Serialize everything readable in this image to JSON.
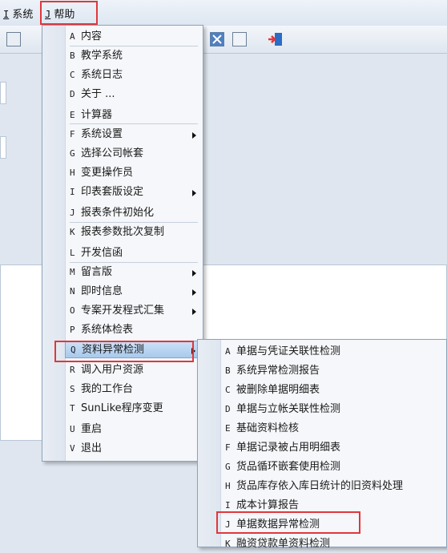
{
  "menubar": {
    "items": [
      {
        "key": "I",
        "label": "系统"
      },
      {
        "key": "J",
        "label": "帮助"
      }
    ]
  },
  "help_menu": {
    "items": [
      {
        "key": "A",
        "label": "内容",
        "submenu": false
      },
      {
        "key": "B",
        "label": "教学系统",
        "submenu": false
      },
      {
        "key": "C",
        "label": "系统日志",
        "submenu": false
      },
      {
        "key": "D",
        "label": "关于 ...",
        "submenu": false
      },
      {
        "key": "E",
        "label": "计算器",
        "submenu": false
      },
      {
        "key": "F",
        "label": "系统设置",
        "submenu": true
      },
      {
        "key": "G",
        "label": "选择公司帐套",
        "submenu": false
      },
      {
        "key": "H",
        "label": "变更操作员",
        "submenu": false
      },
      {
        "key": "I",
        "label": "印表套版设定",
        "submenu": true
      },
      {
        "key": "J",
        "label": "报表条件初始化",
        "submenu": false
      },
      {
        "key": "K",
        "label": "报表参数批次复制",
        "submenu": false
      },
      {
        "key": "L",
        "label": "开发信函",
        "submenu": false
      },
      {
        "key": "M",
        "label": "留言版",
        "submenu": true
      },
      {
        "key": "N",
        "label": "即时信息",
        "submenu": true
      },
      {
        "key": "O",
        "label": "专案开发程式汇集",
        "submenu": true
      },
      {
        "key": "P",
        "label": "系统体检表",
        "submenu": false
      },
      {
        "key": "Q",
        "label": "资料异常检测",
        "submenu": true
      },
      {
        "key": "R",
        "label": "调入用户资源",
        "submenu": false
      },
      {
        "key": "S",
        "label": "我的工作台",
        "submenu": false
      },
      {
        "key": "T",
        "label": "SunLike程序变更",
        "submenu": false
      },
      {
        "key": "U",
        "label": "重启",
        "submenu": false
      },
      {
        "key": "V",
        "label": "退出",
        "submenu": false
      }
    ]
  },
  "sub_menu": {
    "items": [
      {
        "key": "A",
        "label": "单据与凭证关联性检测"
      },
      {
        "key": "B",
        "label": "系统异常检测报告"
      },
      {
        "key": "C",
        "label": "被删除单据明细表"
      },
      {
        "key": "D",
        "label": "单据与立帐关联性检测"
      },
      {
        "key": "E",
        "label": "基础资料检核"
      },
      {
        "key": "F",
        "label": "单据记录被占用明细表"
      },
      {
        "key": "G",
        "label": "货品循环嵌套使用检测"
      },
      {
        "key": "H",
        "label": "货品库存依入库日统计的旧资料处理"
      },
      {
        "key": "I",
        "label": "成本计算报告"
      },
      {
        "key": "J",
        "label": "单据数据异常检测"
      },
      {
        "key": "K",
        "label": "融资贷款单资料检测"
      }
    ]
  },
  "colors": {
    "highlight_border": "#e0373b",
    "active_item": "#b8d3f0"
  }
}
